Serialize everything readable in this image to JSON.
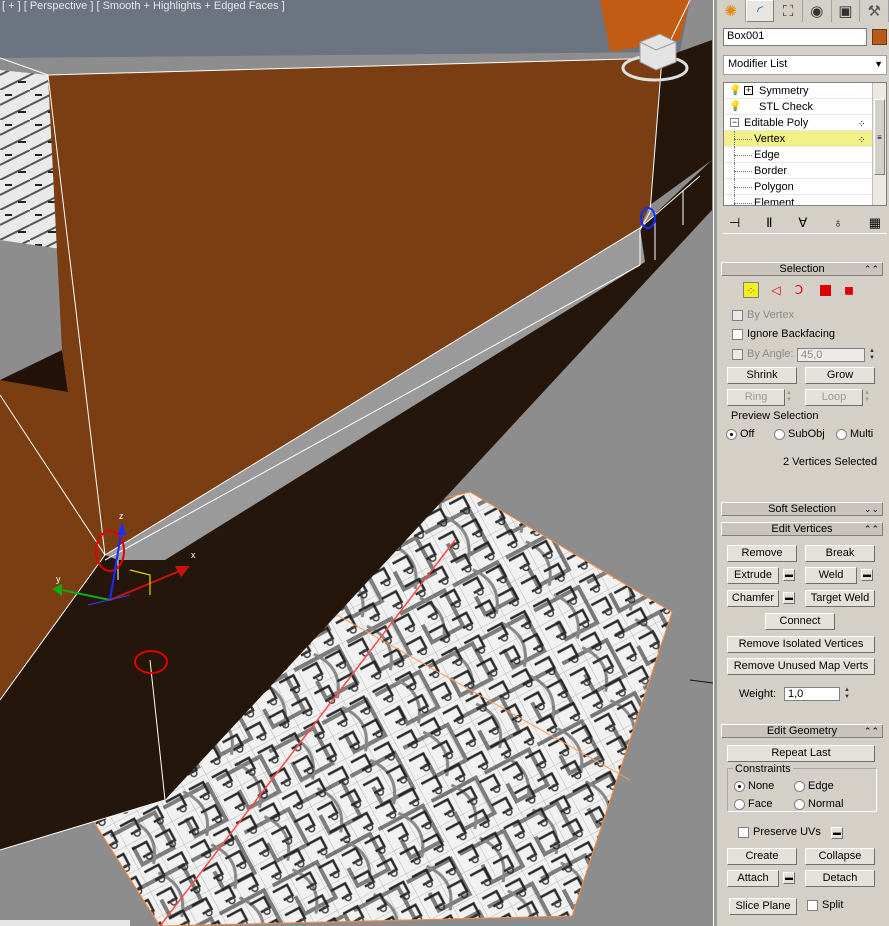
{
  "viewport": {
    "label": "[ + ] [ Perspective ] [ Smooth + Highlights + Edged Faces ]",
    "gizmo_axes": {
      "x": "x",
      "y": "y",
      "z": "z"
    }
  },
  "panel": {
    "tabs": [
      {
        "name": "create-tab",
        "icon": "sun-icon",
        "glyph": "✺"
      },
      {
        "name": "modify-tab",
        "icon": "modify-arc-icon",
        "glyph": "◜"
      },
      {
        "name": "hierarchy-tab",
        "icon": "hierarchy-icon",
        "glyph": "⛶"
      },
      {
        "name": "motion-tab",
        "icon": "motion-icon",
        "glyph": "◉"
      },
      {
        "name": "display-tab",
        "icon": "display-icon",
        "glyph": "▣"
      },
      {
        "name": "utilities-tab",
        "icon": "hammer-icon",
        "glyph": "⚒"
      }
    ],
    "object_name": "Box001",
    "object_color": "#b85a18",
    "modifier_list_label": "Modifier List",
    "stack": [
      {
        "label": "Symmetry"
      },
      {
        "label": "STL Check"
      },
      {
        "label": "Editable Poly"
      },
      {
        "label": "Vertex"
      },
      {
        "label": "Edge"
      },
      {
        "label": "Border"
      },
      {
        "label": "Polygon"
      },
      {
        "label": "Element"
      }
    ],
    "selection": {
      "title": "Selection",
      "by_vertex": "By Vertex",
      "ignore_backfacing": "Ignore Backfacing",
      "by_angle": "By Angle:",
      "angle_value": "45,0",
      "shrink": "Shrink",
      "grow": "Grow",
      "ring": "Ring",
      "loop": "Loop",
      "preview_title": "Preview Selection",
      "preview_off": "Off",
      "preview_subobj": "SubObj",
      "preview_multi": "Multi",
      "status": "2 Vertices Selected"
    },
    "soft_selection": {
      "title": "Soft Selection"
    },
    "edit_vertices": {
      "title": "Edit Vertices",
      "remove": "Remove",
      "break": "Break",
      "extrude": "Extrude",
      "weld": "Weld",
      "chamfer": "Chamfer",
      "target_weld": "Target Weld",
      "connect": "Connect",
      "remove_isolated": "Remove Isolated Vertices",
      "remove_unused": "Remove Unused Map Verts",
      "weight_label": "Weight:",
      "weight_value": "1,0"
    },
    "edit_geometry": {
      "title": "Edit Geometry",
      "repeat_last": "Repeat Last",
      "constraints": "Constraints",
      "none": "None",
      "edge": "Edge",
      "face": "Face",
      "normal": "Normal",
      "preserve_uvs": "Preserve UVs",
      "create": "Create",
      "collapse": "Collapse",
      "attach": "Attach",
      "detach": "Detach",
      "slice_plane": "Slice Plane",
      "split": "Split"
    }
  }
}
